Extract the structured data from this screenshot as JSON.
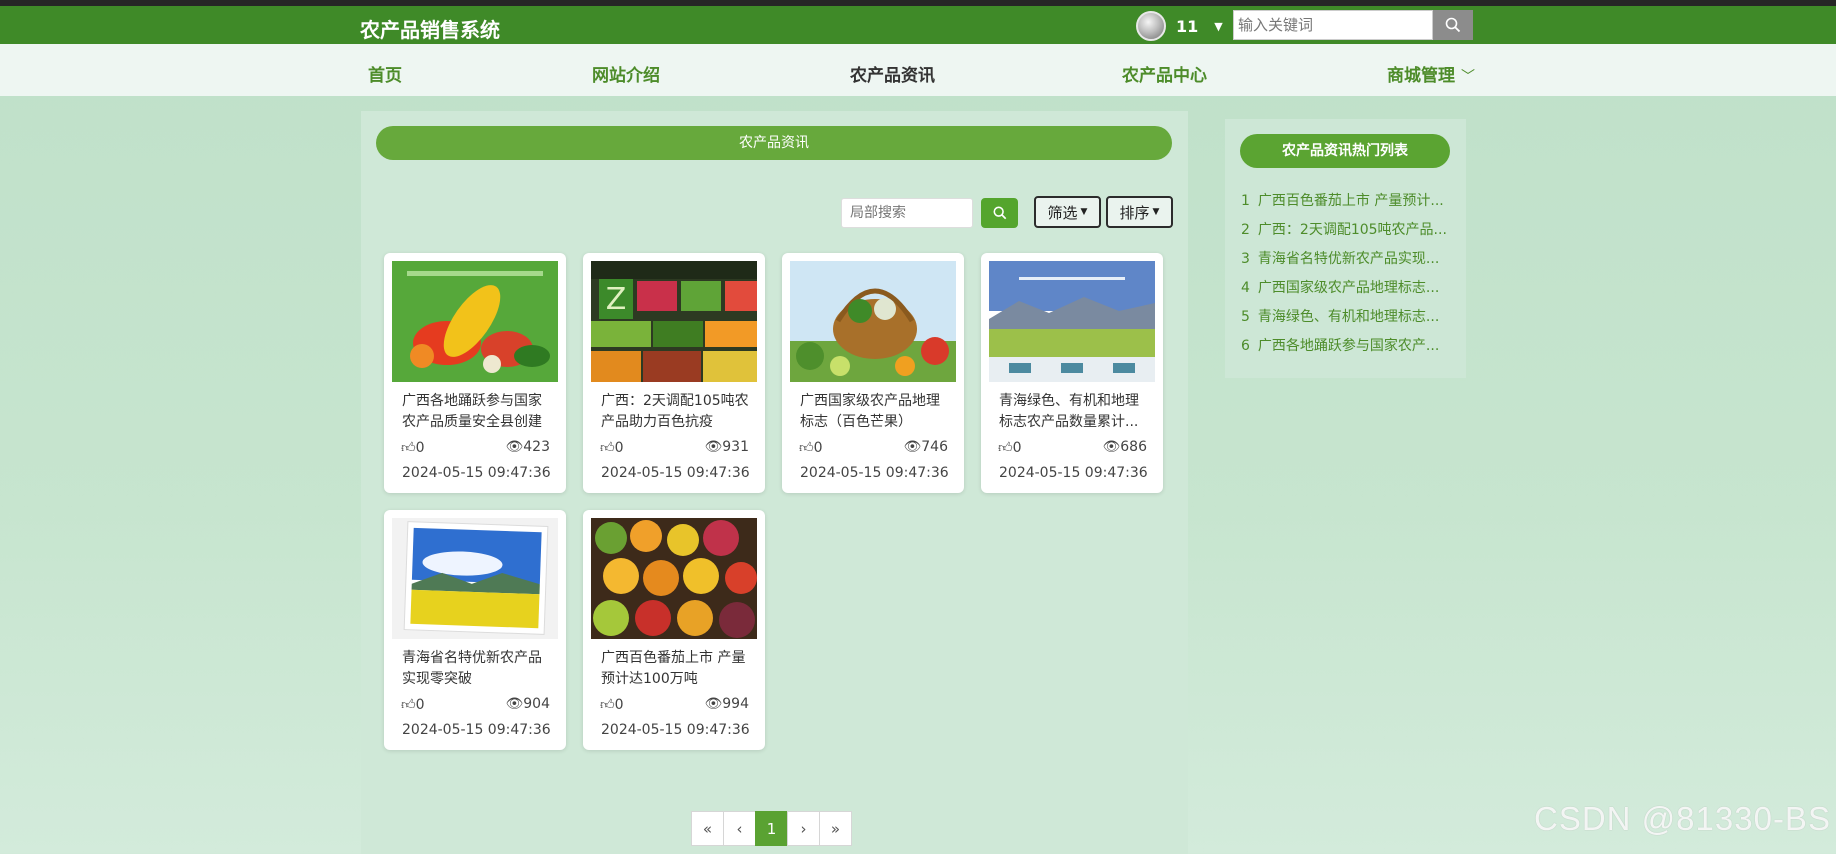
{
  "header": {
    "site_title": "农产品销售系统",
    "user_name": "11",
    "search_placeholder": "输入关键词"
  },
  "nav": {
    "items": [
      {
        "label": "首页"
      },
      {
        "label": "网站介绍"
      },
      {
        "label": "农产品资讯",
        "active": true
      },
      {
        "label": "农产品中心"
      },
      {
        "label": "商城管理"
      }
    ]
  },
  "main": {
    "section_title": "农产品资讯",
    "local_search_placeholder": "局部搜索",
    "filter_label": "筛选",
    "sort_label": "排序",
    "cards": [
      {
        "title": "广西各地踊跃参与国家农产品质量安全县创建",
        "likes": "0",
        "views": "423",
        "date": "2024-05-15 09:47:36"
      },
      {
        "title": "广西：2天调配105吨农产品助力百色抗疫",
        "likes": "0",
        "views": "931",
        "date": "2024-05-15 09:47:36"
      },
      {
        "title": "广西国家级农产品地理标志（百色芒果）",
        "likes": "0",
        "views": "746",
        "date": "2024-05-15 09:47:36"
      },
      {
        "title": "青海绿色、有机和地理标志农产品数量累计...",
        "likes": "0",
        "views": "686",
        "date": "2024-05-15 09:47:36"
      },
      {
        "title": "青海省名特优新农产品实现零突破",
        "likes": "0",
        "views": "904",
        "date": "2024-05-15 09:47:36"
      },
      {
        "title": "广西百色番茄上市 产量预计达100万吨",
        "likes": "0",
        "views": "994",
        "date": "2024-05-15 09:47:36"
      }
    ],
    "pagination": {
      "first": "«",
      "prev": "‹",
      "current": "1",
      "next": "›",
      "last": "»"
    }
  },
  "sidebar": {
    "title": "农产品资讯热门列表",
    "items": [
      {
        "num": "1",
        "text": "广西百色番茄上市 产量预计..."
      },
      {
        "num": "2",
        "text": "广西：2天调配105吨农产品..."
      },
      {
        "num": "3",
        "text": "青海省名特优新农产品实现..."
      },
      {
        "num": "4",
        "text": "广西国家级农产品地理标志..."
      },
      {
        "num": "5",
        "text": "青海绿色、有机和地理标志..."
      },
      {
        "num": "6",
        "text": "广西各地踊跃参与国家农产..."
      }
    ]
  },
  "watermark": "CSDN @81330-BS",
  "colors": {
    "brand_green": "#3f8a28",
    "accent_green": "#5aa232",
    "nav_text": "#4d8c2a"
  }
}
